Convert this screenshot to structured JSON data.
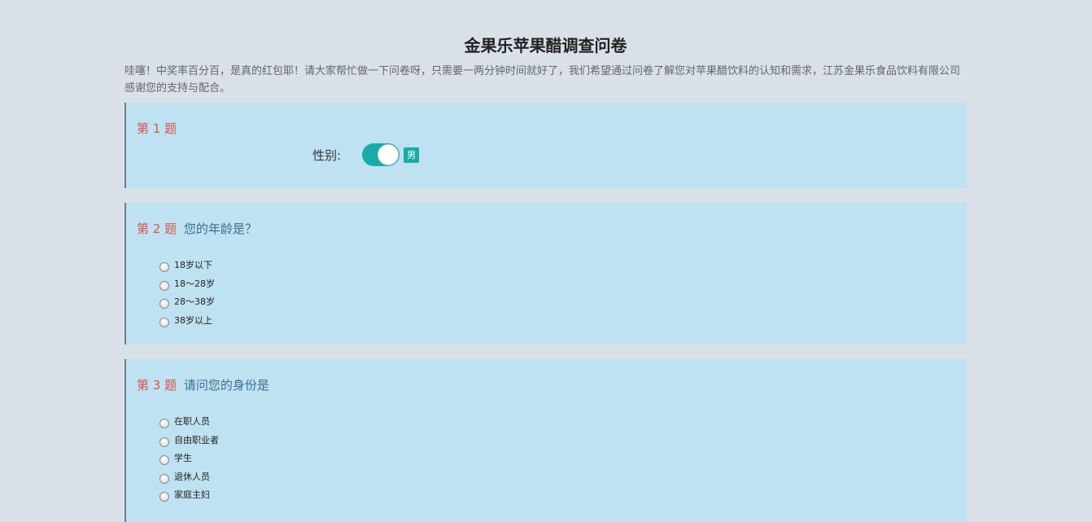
{
  "survey": {
    "title": "金果乐苹果醋调查问卷",
    "intro": "哇噻！中奖率百分百，是真的红包耶！请大家帮忙做一下问卷呀，只需要一两分钟时间就好了，我们希望通过问卷了解您对苹果醋饮料的认知和需求，江苏金果乐食品饮料有限公司感谢您的支持与配合。"
  },
  "questions": [
    {
      "number": "第 1 题",
      "text": "",
      "field_label": "性别:",
      "toggle": {
        "state": "on",
        "value_label": "男"
      }
    },
    {
      "number": "第 2 题",
      "text": "您的年龄是？",
      "options": [
        "18岁以下",
        "18～28岁",
        "28～38岁",
        "38岁以上"
      ]
    },
    {
      "number": "第 3 题",
      "text": "请问您的身份是",
      "options": [
        "在职人员",
        "自由职业者",
        "学生",
        "退休人员",
        "家庭主妇"
      ]
    }
  ],
  "colors": {
    "background": "#d9e0e8",
    "card": "#bee2f1",
    "question_number": "#d9534f",
    "question_text": "#3a6f8f",
    "toggle_on": "#1aaba7"
  }
}
